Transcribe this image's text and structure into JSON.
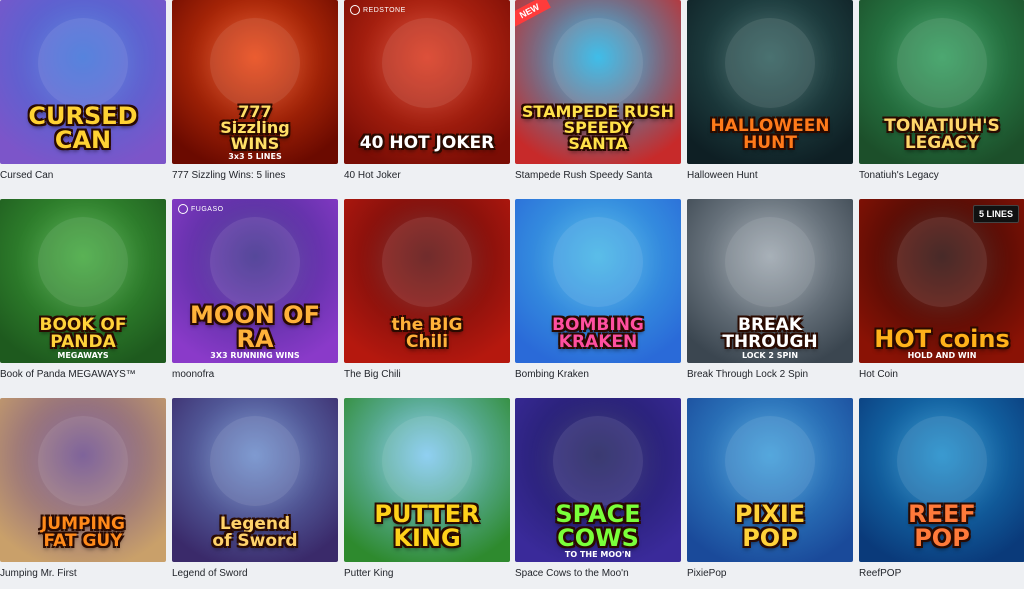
{
  "games": [
    {
      "name": "Cursed Can",
      "art_title": "CURSED\nCAN",
      "colors": [
        "#3b6fd8",
        "#7c55c9"
      ],
      "title_color": "#ffd233"
    },
    {
      "name": "777 Sizzling Wins: 5 lines",
      "art_title": "777\nSizzling\nWINS",
      "art_sub": "3x3  5 LINES",
      "colors": [
        "#e8420f",
        "#6b0a00"
      ],
      "title_color": "#ffe066"
    },
    {
      "name": "40 Hot Joker",
      "art_title": "40 HOT JOKER",
      "provider": "REDSTONE",
      "colors": [
        "#d8341a",
        "#7a0d05"
      ],
      "title_color": "#ffffff"
    },
    {
      "name": "Stampede Rush Speedy Santa",
      "art_title": "STAMPEDE RUSH\nSPEEDY\nSANTA",
      "badge": "NEW",
      "colors": [
        "#20b3e6",
        "#c72a2a"
      ],
      "title_color": "#ffe14a"
    },
    {
      "name": "Halloween Hunt",
      "art_title": "HALLOWEEN\nHUNT",
      "colors": [
        "#2d5b5a",
        "#0e1f24"
      ],
      "title_color": "#ff7a1a"
    },
    {
      "name": "Tonatiuh's Legacy",
      "art_title": "TONATIUH'S\nLEGACY",
      "colors": [
        "#2f9a5a",
        "#1c4f2a"
      ],
      "title_color": "#ffd76a"
    },
    {
      "name": "Book of Panda MEGAWAYS™",
      "art_title": "BOOK OF\nPANDA",
      "art_sub": "MEGAWAYS",
      "colors": [
        "#3fa63a",
        "#1e5a1e"
      ],
      "title_color": "#ffd23a"
    },
    {
      "name": "moonofra",
      "art_title": "MOON OF RA",
      "art_sub": "3X3 RUNNING WINS",
      "provider": "FUGASO",
      "colors": [
        "#3a2a8a",
        "#8a3ac9"
      ],
      "title_color": "#ffb23a"
    },
    {
      "name": "The Big Chili",
      "art_title": "the BIG\nChili",
      "colors": [
        "#5a0a0a",
        "#b5180e"
      ],
      "title_color": "#ffb23a"
    },
    {
      "name": "Bombing Kraken",
      "art_title": "BOMBING\nKRAKEN",
      "colors": [
        "#3fb3e6",
        "#2a6ad8"
      ],
      "title_color": "#ff4fa0"
    },
    {
      "name": "Break Through Lock 2 Spin",
      "art_title": "BREAK\nTHROUGH",
      "art_sub": "LOCK 2 SPIN",
      "colors": [
        "#9aa4ad",
        "#3b4650"
      ],
      "title_color": "#ffffff"
    },
    {
      "name": "Hot Coin",
      "art_title": "HOT coins",
      "art_sub": "HOLD AND WIN",
      "lines_badge": "5 LINES",
      "colors": [
        "#2a0805",
        "#8a1205"
      ],
      "title_color": "#ffb21a"
    },
    {
      "name": "Jumping Mr. First",
      "art_title": "JUMPING\nFAT GUY",
      "colors": [
        "#6a4a8a",
        "#c9a06a"
      ],
      "title_color": "#ff8a1a"
    },
    {
      "name": "Legend of Sword",
      "art_title": "Legend\nof Sword",
      "colors": [
        "#6a8ac9",
        "#3a2a6a"
      ],
      "title_color": "#ffd26a"
    },
    {
      "name": "Putter King",
      "art_title": "PUTTER KING",
      "colors": [
        "#7ec8f0",
        "#2e8a2e"
      ],
      "title_color": "#ffd21a"
    },
    {
      "name": "Space Cows to the Moo'n",
      "art_title": "SPACE COWS",
      "art_sub": "TO THE MOO'N",
      "colors": [
        "#1a1a5a",
        "#3a2a9a"
      ],
      "title_color": "#7aff3a"
    },
    {
      "name": "PixiePop",
      "art_title": "PIXIE\nPOP",
      "colors": [
        "#3a9ad8",
        "#1a4a9a"
      ],
      "title_color": "#ffd23a"
    },
    {
      "name": "ReefPOP",
      "art_title": "REEF\nPOP",
      "colors": [
        "#1a8ac9",
        "#0a3a7a"
      ],
      "title_color": "#ff7a3a"
    }
  ]
}
